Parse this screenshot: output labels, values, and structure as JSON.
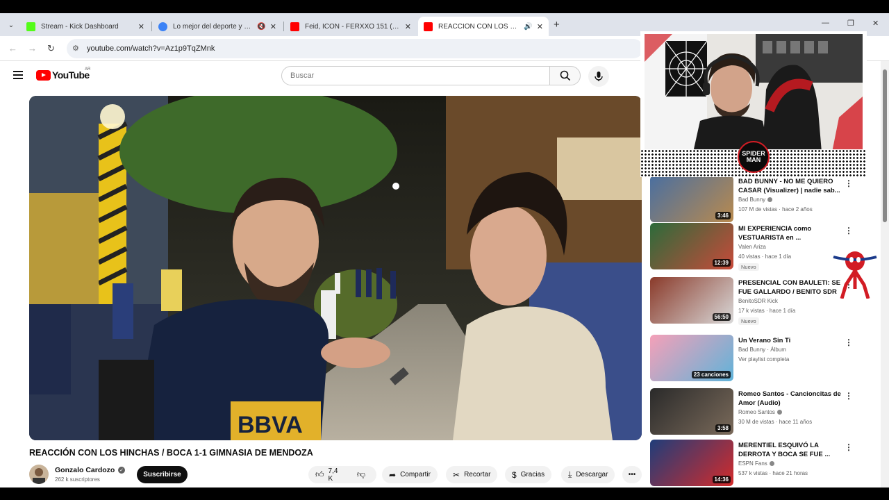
{
  "browser": {
    "tabs": [
      {
        "title": "Stream - Kick Dashboard",
        "favicon_color": "#53fc18",
        "active": false,
        "audio": false
      },
      {
        "title": "Lo mejor del deporte y el e",
        "favicon_color": "#3b82f6",
        "active": false,
        "audio": true
      },
      {
        "title": "Feid, ICON - FERXXO 151 (Offic",
        "favicon_color": "#ff0000",
        "active": false,
        "audio": false
      },
      {
        "title": "REACCIÓN CON LOS HINCH",
        "favicon_color": "#ff0000",
        "active": true,
        "audio": true
      }
    ],
    "new_tab": "+",
    "url": "youtube.com/watch?v=Az1p9TqZMnk"
  },
  "youtube": {
    "logo_text": "YouTube",
    "country": "AR",
    "search_placeholder": "Buscar"
  },
  "video": {
    "title": "REACCIÓN CON LOS HINCHAS / BOCA 1-1 GIMNASIA DE MENDOZA",
    "channel": "Gonzalo Cardozo",
    "subscribers": "262 k suscriptores",
    "subscribe_label": "Suscribirse",
    "likes": "7,4 K",
    "share_label": "Compartir",
    "clip_label": "Recortar",
    "thanks_label": "Gracias",
    "download_label": "Descargar",
    "more_label": "•••"
  },
  "sidebar": [
    {
      "title": "BAD BUNNY - NO ME QUIERO CASAR (Visualizer) | nadie sab...",
      "channel": "Bad Bunny",
      "verified": true,
      "meta": "107 M de vistas · hace 2 años",
      "duration": "3:46",
      "badge": "",
      "thumb_colors": [
        "#4a6fa0",
        "#b98a4e"
      ]
    },
    {
      "title": "MI EXPERIENCIA como VESTUARISTA en ...",
      "channel": "Valen Ariza",
      "verified": false,
      "meta": "40 vistas · hace 1 día",
      "duration": "12:39",
      "badge": "Nuevo",
      "thumb_colors": [
        "#2c6b3a",
        "#c84a3a"
      ]
    },
    {
      "title": "PRESENCIAL CON BAULETI: SE FUE GALLARDO / BENITO SDR",
      "channel": "BenitoSDR Kick",
      "verified": false,
      "meta": "17 k vistas · hace 1 día",
      "duration": "56:50",
      "badge": "Nuevo",
      "thumb_colors": [
        "#8a3a2a",
        "#d9d9d9"
      ]
    },
    {
      "title": "Un Verano Sin Ti",
      "channel": "Bad Bunny · Álbum",
      "verified": false,
      "meta": "Ver playlist completa",
      "duration": "23 canciones",
      "badge": "",
      "thumb_colors": [
        "#f5a0b8",
        "#5fb3d9"
      ]
    },
    {
      "title": "Romeo Santos - Cancioncitas de Amor (Audio)",
      "channel": "Romeo Santos",
      "verified": true,
      "meta": "30 M de vistas · hace 11 años",
      "duration": "3:58",
      "badge": "",
      "thumb_colors": [
        "#2a2a2a",
        "#7a6a5a"
      ]
    },
    {
      "title": "MERENTIEL ESQUIVÓ LA DERROTA Y BOCA SE FUE ...",
      "channel": "ESPN Fans",
      "verified": true,
      "meta": "537 k vistas · hace 21 horas",
      "duration": "14:36",
      "badge": "",
      "thumb_colors": [
        "#1f3d7a",
        "#d42b2b"
      ]
    }
  ],
  "overlay": {
    "cam_logo": "SPIDER MAN"
  }
}
